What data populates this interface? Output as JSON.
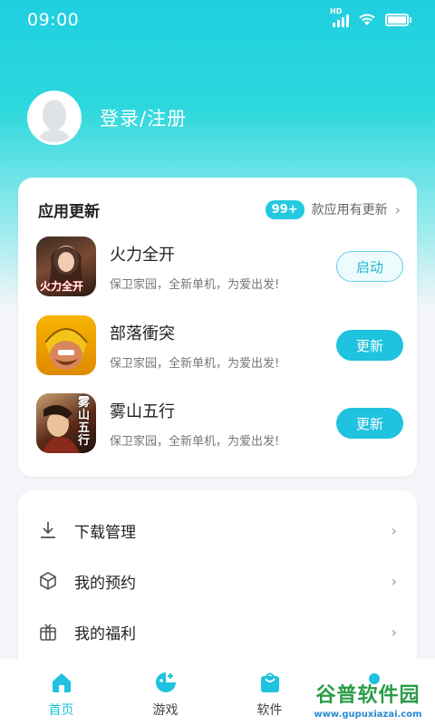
{
  "status_bar": {
    "time": "09:00",
    "network_label": "HD"
  },
  "profile": {
    "login_text": "登录/注册"
  },
  "updates": {
    "title": "应用更新",
    "badge": "99+",
    "summary": "款应用有更新",
    "apps": [
      {
        "name": "火力全开",
        "icon_text": "火力全开",
        "desc": "保卫家园，全新单机，为爱出发!",
        "action": "启动",
        "action_style": "outline"
      },
      {
        "name": "部落衝突",
        "desc": "保卫家园，全新单机，为爱出发!",
        "action": "更新",
        "action_style": "solid"
      },
      {
        "name": "雾山五行",
        "icon_text": "雾山五行",
        "desc": "保卫家园，全新单机，为爱出发!",
        "action": "更新",
        "action_style": "solid"
      }
    ]
  },
  "menu": [
    {
      "label": "下载管理",
      "icon": "download-icon"
    },
    {
      "label": "我的预约",
      "icon": "box-icon"
    },
    {
      "label": "我的福利",
      "icon": "gift-icon"
    }
  ],
  "tabbar": [
    {
      "label": "首页",
      "icon": "home-icon",
      "active": true
    },
    {
      "label": "游戏",
      "icon": "game-icon",
      "active": false
    },
    {
      "label": "软件",
      "icon": "bag-icon",
      "active": false
    }
  ],
  "watermark": {
    "title": "谷普软件园",
    "url": "www.gupuxiazai.com"
  },
  "colors": {
    "accent": "#1fc2df",
    "hero_top": "#1fcfe0"
  }
}
